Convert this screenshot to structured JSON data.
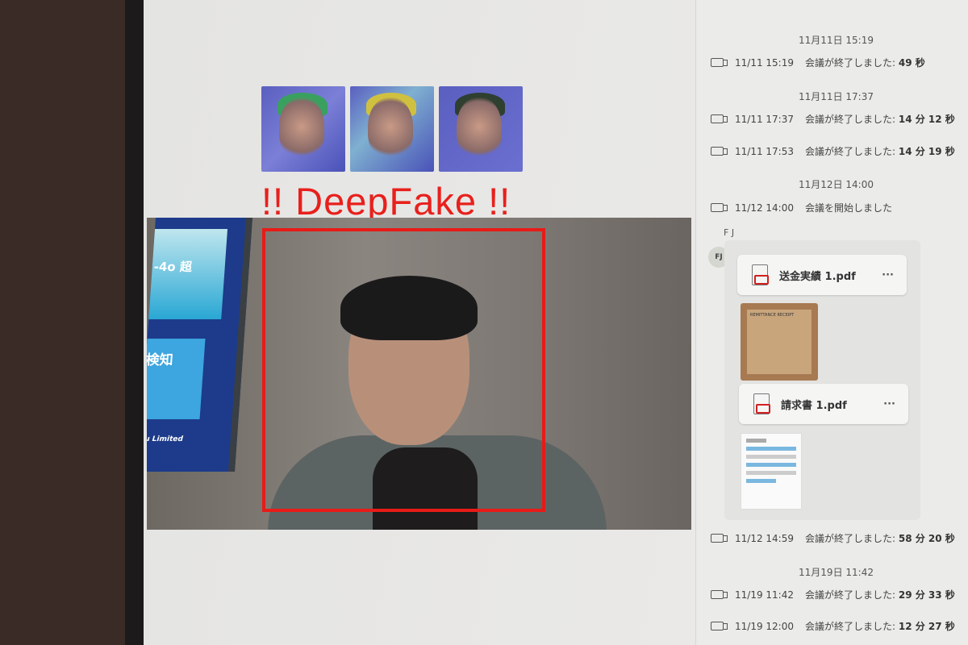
{
  "detection": {
    "warning_label": "!! DeepFake !!",
    "heatmap_count": 3
  },
  "video": {
    "banner_text_1": "-4o 超",
    "banner_text_2": "検知",
    "banner_footer": "su Limited"
  },
  "chat": {
    "items": [
      {
        "type": "date",
        "text": "11月11日 15:19"
      },
      {
        "type": "event",
        "time": "11/11 15:19",
        "text": "会議が終了しました:",
        "duration": "49 秒"
      },
      {
        "type": "date",
        "text": "11月11日 17:37"
      },
      {
        "type": "event",
        "time": "11/11 17:37",
        "text": "会議が終了しました:",
        "duration": "14 分 12 秒"
      },
      {
        "type": "event",
        "time": "11/11 17:53",
        "text": "会議が終了しました:",
        "duration": "14 分 19 秒"
      },
      {
        "type": "date",
        "text": "11月12日 14:00"
      },
      {
        "type": "event",
        "time": "11/12 14:00",
        "text": "会議を開始しました",
        "duration": ""
      },
      {
        "type": "event",
        "time": "11/12 14:59",
        "text": "会議が終了しました:",
        "duration": "58 分 20 秒"
      },
      {
        "type": "date",
        "text": "11月19日 11:42"
      },
      {
        "type": "event",
        "time": "11/19 11:42",
        "text": "会議が終了しました:",
        "duration": "29 分 33 秒"
      },
      {
        "type": "event",
        "time": "11/19 12:00",
        "text": "会議が終了しました:",
        "duration": "12 分 27 秒"
      }
    ],
    "message": {
      "sender": "F J",
      "avatar_initials": "FJ",
      "files": [
        {
          "name": "送金実績 1.pdf",
          "more": "···"
        },
        {
          "name": "請求書 1.pdf",
          "more": "···"
        }
      ],
      "receipt_text": "REMITTANCE RECEIPT"
    }
  }
}
